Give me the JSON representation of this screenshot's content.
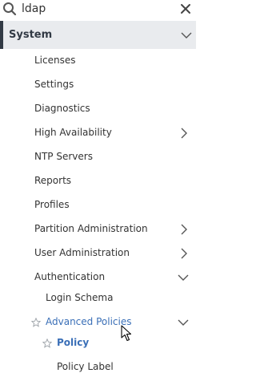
{
  "search": {
    "value": "ldap",
    "search_icon": "search-icon",
    "clear_icon": "close-icon"
  },
  "system": {
    "label": "System",
    "expanded": true,
    "icon": "chevron-down-icon"
  },
  "items": [
    {
      "label": "Licenses"
    },
    {
      "label": "Settings"
    },
    {
      "label": "Diagnostics"
    },
    {
      "label": "High Availability",
      "icon": "chevron-right-icon"
    },
    {
      "label": "NTP Servers"
    },
    {
      "label": "Reports"
    },
    {
      "label": "Profiles"
    },
    {
      "label": "Partition Administration",
      "icon": "chevron-right-icon"
    },
    {
      "label": "User Administration",
      "icon": "chevron-right-icon"
    },
    {
      "label": "Authentication",
      "icon": "chevron-down-icon"
    }
  ],
  "authentication_children": {
    "login_schema": "Login Schema",
    "advanced_policies": {
      "label": "Advanced Policies",
      "icon": "chevron-down-icon",
      "star_icon": "star-icon"
    },
    "policy": {
      "label": "Policy",
      "star_icon": "star-icon"
    },
    "policy_label": "Policy Label"
  },
  "colors": {
    "accent": "#3a6fb7",
    "header_bg": "#e9ebee",
    "header_bar": "#323a45",
    "text": "#333333"
  }
}
